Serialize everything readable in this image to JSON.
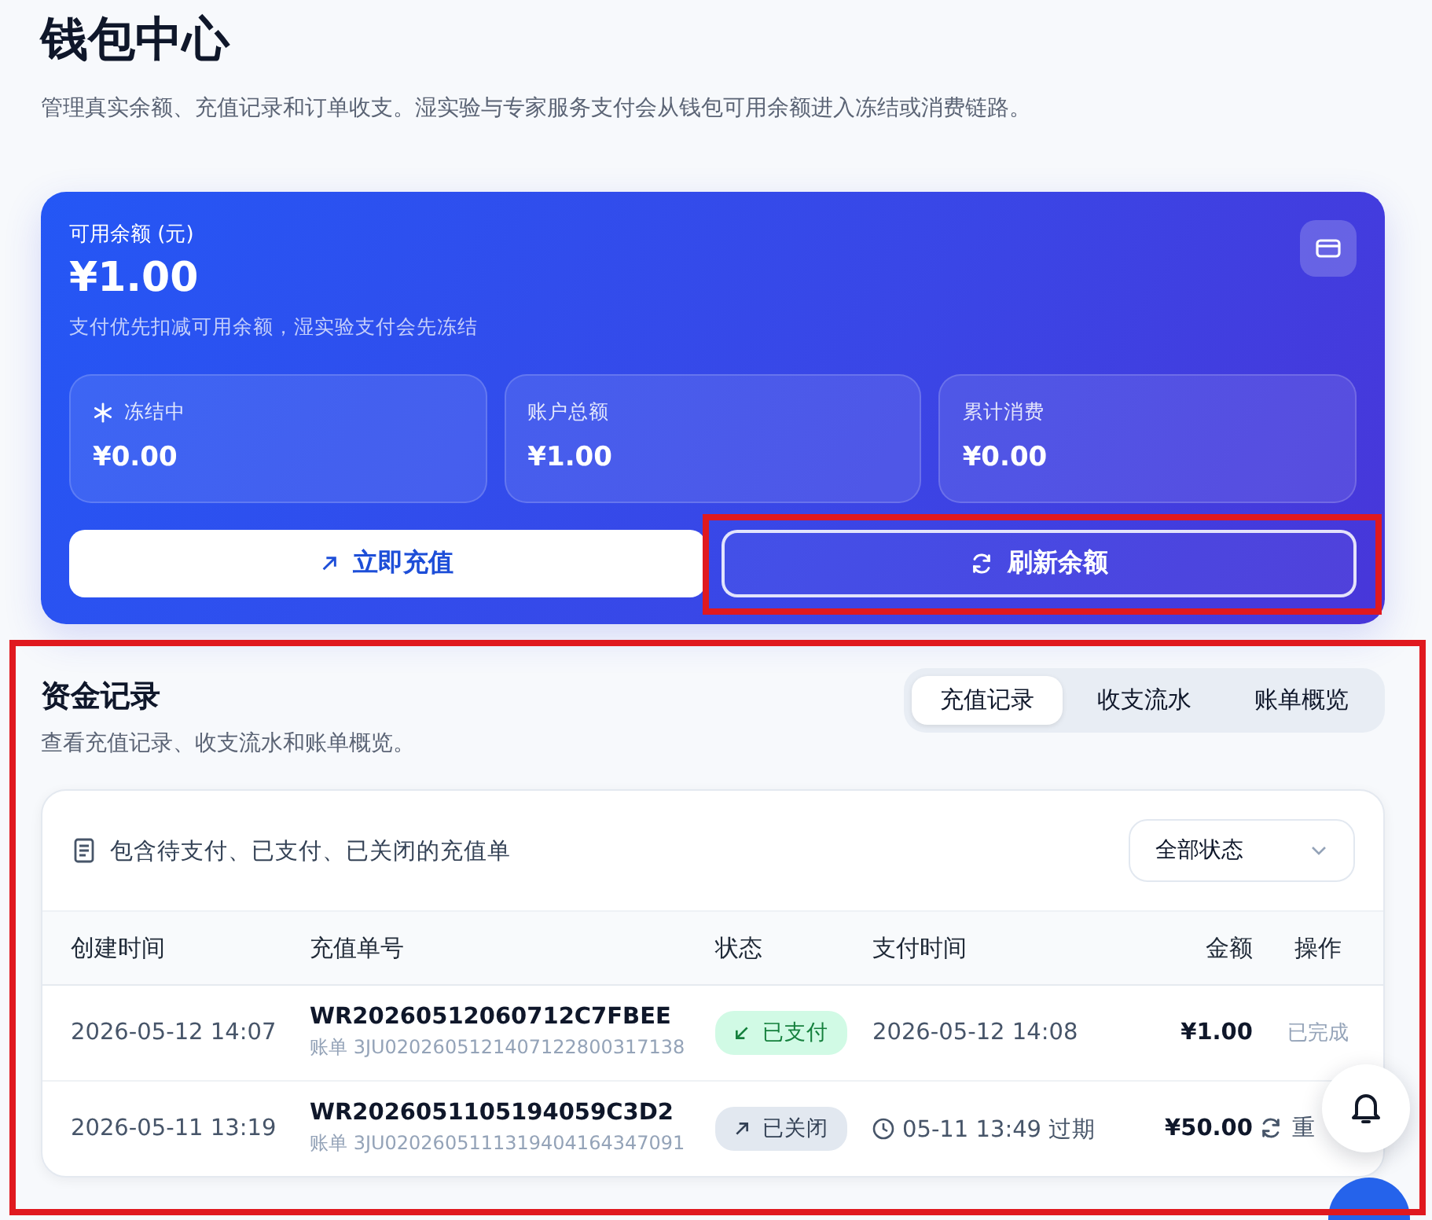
{
  "page": {
    "title": "钱包中心",
    "subtitle": "管理真实余额、充值记录和订单收支。湿实验与专家服务支付会从钱包可用余额进入冻结或消费链路。"
  },
  "balance_card": {
    "label": "可用余额 (元)",
    "amount": "¥1.00",
    "note": "支付优先扣减可用余额，湿实验支付会先冻结",
    "stats": [
      {
        "label": "冻结中",
        "value": "¥0.00",
        "kind": "frozen"
      },
      {
        "label": "账户总额",
        "value": "¥1.00",
        "kind": "plain"
      },
      {
        "label": "累计消费",
        "value": "¥0.00",
        "kind": "plain"
      }
    ],
    "buttons": [
      {
        "label": "立即充值",
        "kind": "primary"
      },
      {
        "label": "刷新余额",
        "kind": "outline"
      }
    ]
  },
  "records": {
    "title": "资金记录",
    "subtitle": "查看充值记录、收支流水和账单概览。",
    "tabs": [
      {
        "label": "充值记录",
        "selected": true
      },
      {
        "label": "收支流水",
        "selected": false
      },
      {
        "label": "账单概览",
        "selected": false
      }
    ],
    "filter_note": "包含待支付、已支付、已关闭的充值单",
    "status_select": {
      "value": "全部状态"
    },
    "table": {
      "columns": [
        "创建时间",
        "充值单号",
        "状态",
        "支付时间",
        "金额",
        "操作"
      ],
      "rows": [
        {
          "created": "2026-05-12 14:07",
          "order_no": "WR20260512060712C7FBEE",
          "bill": "账单 3JU0202605121407122800317138",
          "status": {
            "label": "已支付",
            "kind": "paid"
          },
          "pay_time": {
            "text": "2026-05-12 14:08",
            "kind": "paid"
          },
          "amount": "¥1.00",
          "action": {
            "label": "已完成",
            "kind": "done"
          }
        },
        {
          "created": "2026-05-11 13:19",
          "order_no": "WR2026051105194059C3D2",
          "bill": "账单 3JU0202605111319404164347091",
          "status": {
            "label": "已关闭",
            "kind": "closed"
          },
          "pay_time": {
            "text": "05-11 13:49 过期",
            "kind": "expired"
          },
          "amount": "¥50.00",
          "action": {
            "label": "重",
            "kind": "retry"
          }
        }
      ]
    }
  }
}
